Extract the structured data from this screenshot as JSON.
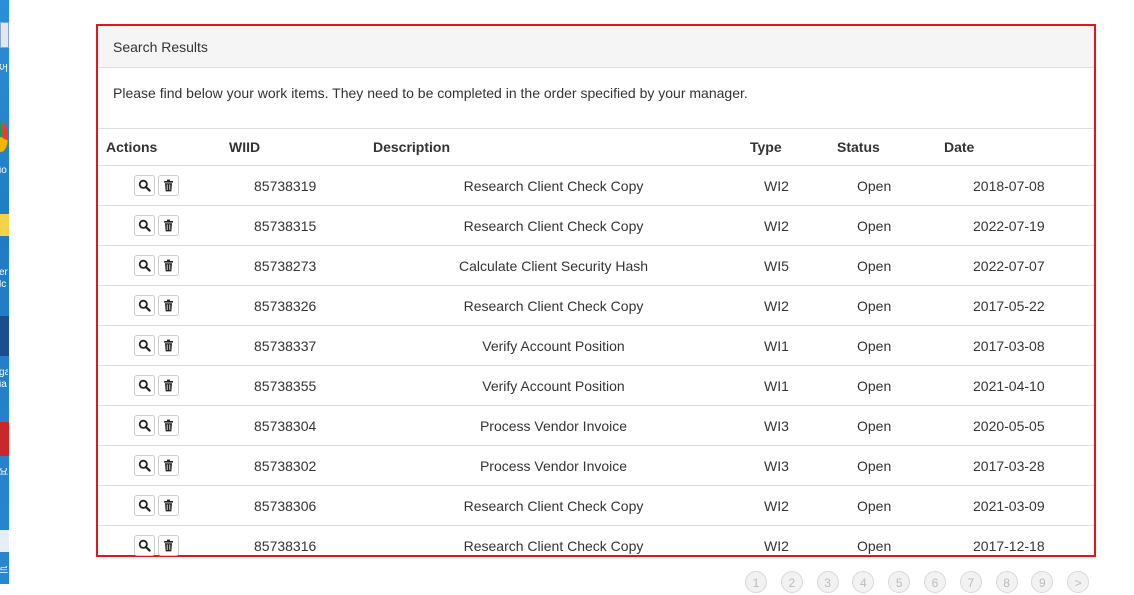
{
  "desktop": {
    "fragments": [
      "어",
      "io",
      "er",
      "lc",
      "ga",
      "ia",
      "요",
      "르"
    ]
  },
  "panel": {
    "title": "Search Results",
    "intro": "Please find below your work items. They need to be completed in the order specified by your manager."
  },
  "table": {
    "headers": {
      "actions": "Actions",
      "wiid": "WIID",
      "description": "Description",
      "type": "Type",
      "status": "Status",
      "date": "Date"
    },
    "rows": [
      {
        "wiid": "85738319",
        "description": "Research Client Check Copy",
        "type": "WI2",
        "status": "Open",
        "date": "2018-07-08"
      },
      {
        "wiid": "85738315",
        "description": "Research Client Check Copy",
        "type": "WI2",
        "status": "Open",
        "date": "2022-07-19"
      },
      {
        "wiid": "85738273",
        "description": "Calculate Client Security Hash",
        "type": "WI5",
        "status": "Open",
        "date": "2022-07-07"
      },
      {
        "wiid": "85738326",
        "description": "Research Client Check Copy",
        "type": "WI2",
        "status": "Open",
        "date": "2017-05-22"
      },
      {
        "wiid": "85738337",
        "description": "Verify Account Position",
        "type": "WI1",
        "status": "Open",
        "date": "2017-03-08"
      },
      {
        "wiid": "85738355",
        "description": "Verify Account Position",
        "type": "WI1",
        "status": "Open",
        "date": "2021-04-10"
      },
      {
        "wiid": "85738304",
        "description": "Process Vendor Invoice",
        "type": "WI3",
        "status": "Open",
        "date": "2020-05-05"
      },
      {
        "wiid": "85738302",
        "description": "Process Vendor Invoice",
        "type": "WI3",
        "status": "Open",
        "date": "2017-03-28"
      },
      {
        "wiid": "85738306",
        "description": "Research Client Check Copy",
        "type": "WI2",
        "status": "Open",
        "date": "2021-03-09"
      },
      {
        "wiid": "85738316",
        "description": "Research Client Check Copy",
        "type": "WI2",
        "status": "Open",
        "date": "2017-12-18"
      }
    ],
    "action_icons": [
      "search-icon",
      "trash-icon"
    ]
  },
  "pagination": {
    "pages": [
      "1",
      "2",
      "3",
      "4",
      "5",
      "6",
      "7",
      "8",
      "9",
      ">"
    ]
  },
  "colors": {
    "highlight_border": "#e3141b",
    "heading_bg": "#f5f5f5",
    "desktop_blue": "#2b8fd6"
  }
}
